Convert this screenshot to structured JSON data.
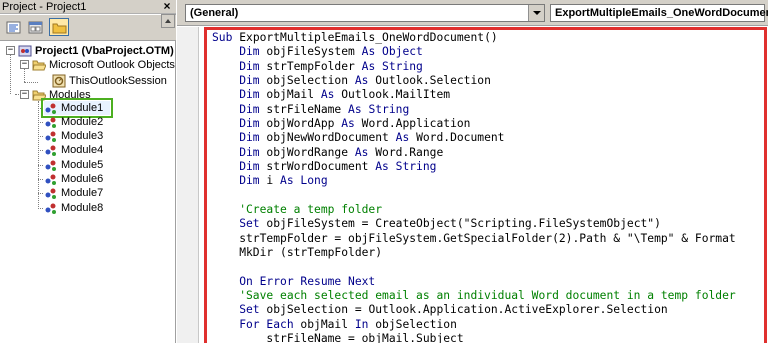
{
  "project_pane": {
    "title": "Project - Project1",
    "close_glyph": "×",
    "toolbar": {
      "view_code_icon": "view-code-icon",
      "view_object_icon": "view-object-icon",
      "toggle_folders_icon": "folder-icon"
    },
    "tree": {
      "project": {
        "label": "Project1 (VbaProject.OTM)",
        "expander": "−"
      },
      "outlook_objects": {
        "label": "Microsoft Outlook Objects",
        "expander": "−"
      },
      "this_outlook_session": {
        "label": "ThisOutlookSession"
      },
      "modules_folder": {
        "label": "Modules",
        "expander": "−"
      },
      "modules": [
        "Module1",
        "Module2",
        "Module3",
        "Module4",
        "Module5",
        "Module6",
        "Module7",
        "Module8"
      ],
      "selected_module": "Module1"
    }
  },
  "code_window": {
    "object_combo": "(General)",
    "procedure_combo": "ExportMultipleEmails_OneWordDocument",
    "lines": [
      [
        {
          "t": "kw",
          "s": "Sub "
        },
        {
          "t": "tx",
          "s": "ExportMultipleEmails_OneWordDocument()"
        }
      ],
      [
        {
          "t": "kw",
          "s": "    Dim "
        },
        {
          "t": "tx",
          "s": "objFileSystem "
        },
        {
          "t": "kw",
          "s": "As Object"
        }
      ],
      [
        {
          "t": "kw",
          "s": "    Dim "
        },
        {
          "t": "tx",
          "s": "strTempFolder "
        },
        {
          "t": "kw",
          "s": "As String"
        }
      ],
      [
        {
          "t": "kw",
          "s": "    Dim "
        },
        {
          "t": "tx",
          "s": "objSelection "
        },
        {
          "t": "kw",
          "s": "As "
        },
        {
          "t": "tx",
          "s": "Outlook.Selection"
        }
      ],
      [
        {
          "t": "kw",
          "s": "    Dim "
        },
        {
          "t": "tx",
          "s": "objMail "
        },
        {
          "t": "kw",
          "s": "As "
        },
        {
          "t": "tx",
          "s": "Outlook.MailItem"
        }
      ],
      [
        {
          "t": "kw",
          "s": "    Dim "
        },
        {
          "t": "tx",
          "s": "strFileName "
        },
        {
          "t": "kw",
          "s": "As String"
        }
      ],
      [
        {
          "t": "kw",
          "s": "    Dim "
        },
        {
          "t": "tx",
          "s": "objWordApp "
        },
        {
          "t": "kw",
          "s": "As "
        },
        {
          "t": "tx",
          "s": "Word.Application"
        }
      ],
      [
        {
          "t": "kw",
          "s": "    Dim "
        },
        {
          "t": "tx",
          "s": "objNewWordDocument "
        },
        {
          "t": "kw",
          "s": "As "
        },
        {
          "t": "tx",
          "s": "Word.Document"
        }
      ],
      [
        {
          "t": "kw",
          "s": "    Dim "
        },
        {
          "t": "tx",
          "s": "objWordRange "
        },
        {
          "t": "kw",
          "s": "As "
        },
        {
          "t": "tx",
          "s": "Word.Range"
        }
      ],
      [
        {
          "t": "kw",
          "s": "    Dim "
        },
        {
          "t": "tx",
          "s": "strWordDocument "
        },
        {
          "t": "kw",
          "s": "As String"
        }
      ],
      [
        {
          "t": "kw",
          "s": "    Dim "
        },
        {
          "t": "tx",
          "s": "i "
        },
        {
          "t": "kw",
          "s": "As Long"
        }
      ],
      [
        {
          "t": "tx",
          "s": ""
        }
      ],
      [
        {
          "t": "cm",
          "s": "    'Create a temp folder"
        }
      ],
      [
        {
          "t": "kw",
          "s": "    Set "
        },
        {
          "t": "tx",
          "s": "objFileSystem = CreateObject(\"Scripting.FileSystemObject\")"
        }
      ],
      [
        {
          "t": "tx",
          "s": "    strTempFolder = objFileSystem.GetSpecialFolder(2).Path & \"\\Temp\" & Format"
        }
      ],
      [
        {
          "t": "tx",
          "s": "    MkDir (strTempFolder)"
        }
      ],
      [
        {
          "t": "tx",
          "s": ""
        }
      ],
      [
        {
          "t": "kw",
          "s": "    On Error Resume Next"
        }
      ],
      [
        {
          "t": "cm",
          "s": "    'Save each selected email as an individual Word document in a temp folder"
        }
      ],
      [
        {
          "t": "kw",
          "s": "    Set "
        },
        {
          "t": "tx",
          "s": "objSelection = Outlook.Application.ActiveExplorer.Selection"
        }
      ],
      [
        {
          "t": "kw",
          "s": "    For Each "
        },
        {
          "t": "tx",
          "s": "objMail "
        },
        {
          "t": "kw",
          "s": "In "
        },
        {
          "t": "tx",
          "s": "objSelection"
        }
      ],
      [
        {
          "t": "tx",
          "s": "        strFileName = objMail.Subject"
        }
      ]
    ]
  },
  "colors": {
    "keyword": "#00008b",
    "comment": "#008000",
    "highlight_frame": "#e0302e",
    "selection_outline": "#4caf20"
  }
}
